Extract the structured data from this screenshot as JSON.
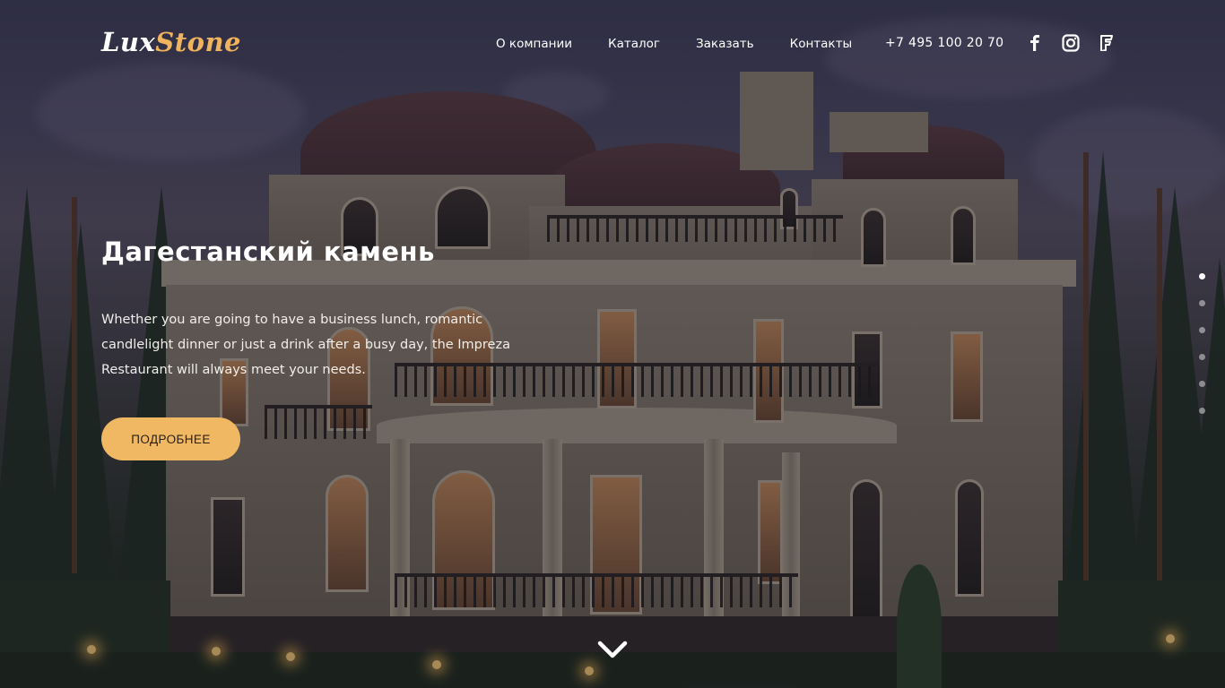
{
  "header": {
    "logo_part1": "Lux",
    "logo_part2": "Stone",
    "nav": [
      {
        "label": "О компании"
      },
      {
        "label": "Каталог"
      },
      {
        "label": "Заказать"
      },
      {
        "label": "Контакты"
      }
    ],
    "phone": "+7 495 100 20 70",
    "social_icons": [
      "facebook-icon",
      "instagram-icon",
      "foursquare-icon"
    ]
  },
  "hero": {
    "title": "Дагестанский камень",
    "description": "Whether you are going to have a business lunch, romantic candlelight dinner or just a drink after a busy day, the Impreza Restaurant will always meet your needs.",
    "button_label": "ПОДРОБНЕЕ",
    "slides_total": 6,
    "active_slide": 1
  },
  "colors": {
    "accent": "#f0b862",
    "logo_accent": "#f0b45e"
  }
}
